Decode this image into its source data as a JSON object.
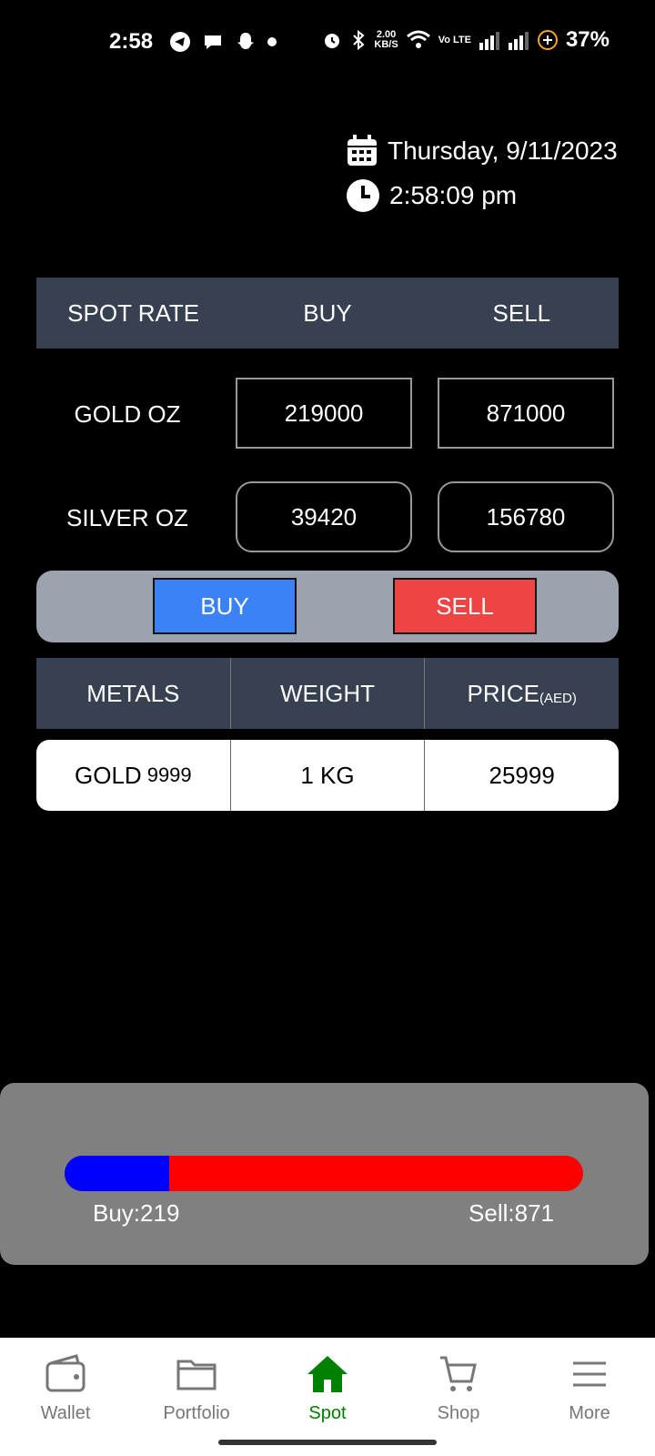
{
  "status_bar": {
    "time": "2:58",
    "net_speed_value": "2.00",
    "net_speed_unit": "KB/S",
    "volte": "Vo LTE",
    "battery": "37%"
  },
  "header": {
    "date": "Thursday, 9/11/2023",
    "time": "2:58:09 pm"
  },
  "spot_table": {
    "headers": [
      "SPOT RATE",
      "BUY",
      "SELL"
    ],
    "rows": [
      {
        "label": "GOLD OZ",
        "buy": "219000",
        "sell": "871000"
      },
      {
        "label": "SILVER OZ",
        "buy": "39420",
        "sell": "156780"
      }
    ]
  },
  "actions": {
    "buy_label": "BUY",
    "sell_label": "SELL"
  },
  "metals_table": {
    "headers": {
      "metals": "METALS",
      "weight": "WEIGHT",
      "price": "PRICE",
      "price_unit": "(AED)"
    },
    "row": {
      "metal": "GOLD",
      "purity": "9999",
      "weight": "1 KG",
      "price": "25999"
    }
  },
  "ratio": {
    "buy_label": "Buy:219",
    "sell_label": "Sell:871",
    "buy_value": 219,
    "sell_value": 871,
    "buy_color": "#0000ff",
    "sell_color": "#ff0000"
  },
  "nav": [
    {
      "label": "Wallet",
      "icon": "wallet-icon",
      "active": false
    },
    {
      "label": "Portfolio",
      "icon": "folder-icon",
      "active": false
    },
    {
      "label": "Spot",
      "icon": "home-icon",
      "active": true
    },
    {
      "label": "Shop",
      "icon": "cart-icon",
      "active": false
    },
    {
      "label": "More",
      "icon": "menu-icon",
      "active": false
    }
  ],
  "colors": {
    "table_header": "#374152",
    "buy_button": "#3b82f6",
    "sell_button": "#ef4444",
    "active_nav": "#008000"
  }
}
